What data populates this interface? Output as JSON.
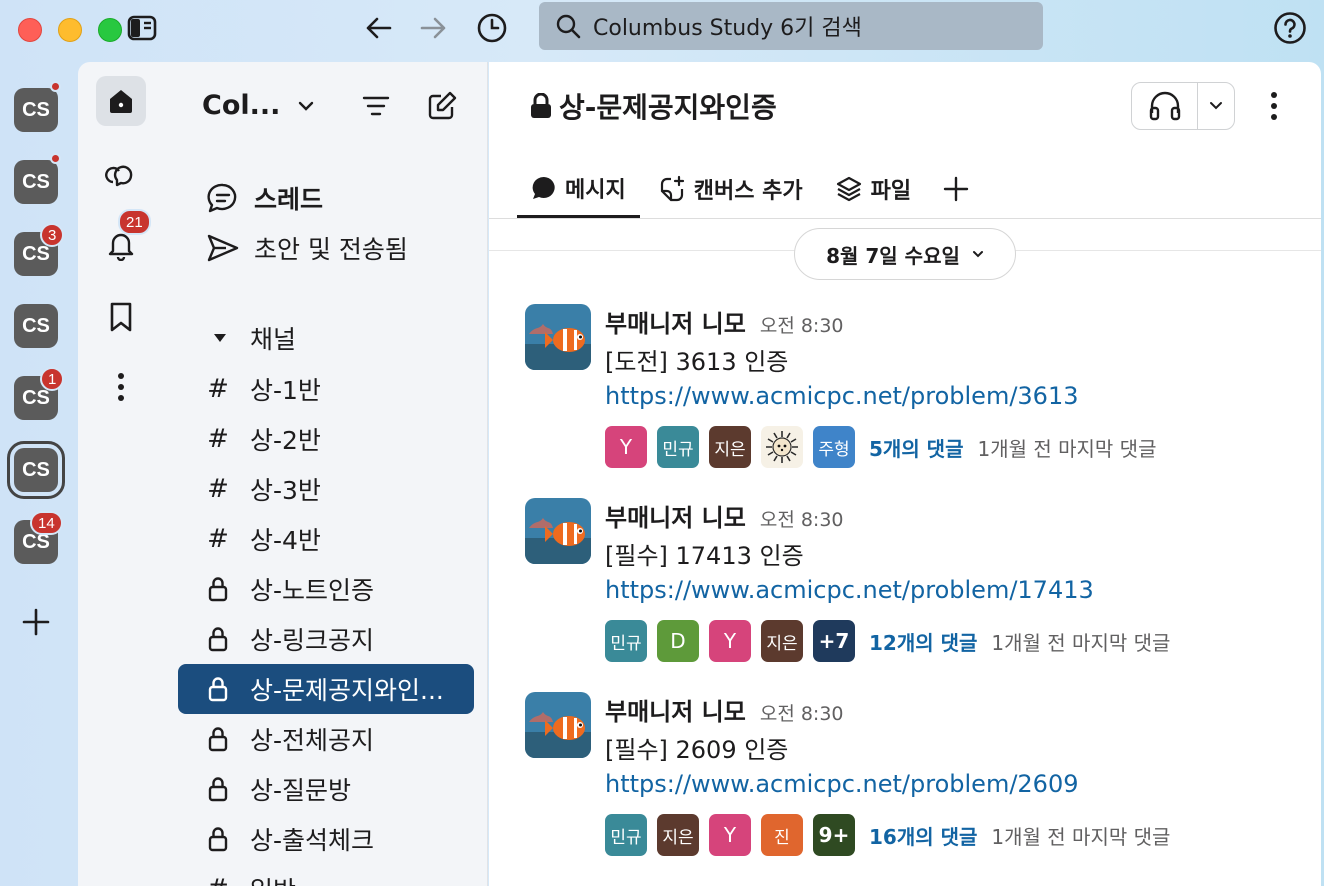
{
  "titlebar": {
    "search_text": "Columbus Study 6기 검색"
  },
  "workspaces": [
    {
      "label": "CS",
      "dot": true,
      "badge": ""
    },
    {
      "label": "CS",
      "dot": true,
      "badge": ""
    },
    {
      "label": "CS",
      "dot": false,
      "badge": "3"
    },
    {
      "label": "CS",
      "dot": false,
      "badge": ""
    },
    {
      "label": "CS",
      "dot": false,
      "badge": "1"
    },
    {
      "label": "CS",
      "dot": false,
      "badge": "",
      "active": true
    },
    {
      "label": "CS",
      "dot": false,
      "badge": "14"
    }
  ],
  "rail": {
    "activity_badge": "21"
  },
  "sidebar": {
    "workspace_name": "Col...",
    "threads_label": "스레드",
    "drafts_label": "초안 및 전송됨",
    "channels_header": "채널",
    "channels": [
      {
        "icon": "#",
        "name": "상-1반"
      },
      {
        "icon": "#",
        "name": "상-2반"
      },
      {
        "icon": "#",
        "name": "상-3반"
      },
      {
        "icon": "#",
        "name": "상-4반"
      },
      {
        "icon": "lock",
        "name": "상-노트인증"
      },
      {
        "icon": "lock",
        "name": "상-링크공지"
      },
      {
        "icon": "lock",
        "name": "상-문제공지와인...",
        "active": true
      },
      {
        "icon": "lock",
        "name": "상-전체공지"
      },
      {
        "icon": "lock",
        "name": "상-질문방"
      },
      {
        "icon": "lock",
        "name": "상-출석체크"
      },
      {
        "icon": "#",
        "name": "일반"
      }
    ]
  },
  "channel": {
    "title": "상-문제공지와인증",
    "tabs": [
      {
        "label": "메시지",
        "active": true
      },
      {
        "label": "캔버스 추가"
      },
      {
        "label": "파일"
      }
    ],
    "date_divider": "8월 7일 수요일"
  },
  "messages": [
    {
      "author": "부매니저 니모",
      "time": "오전 8:30",
      "text": "[도전] 3613 인증",
      "link": "https://www.acmicpc.net/problem/3613",
      "repliers": [
        {
          "label": "Y",
          "color": "#d6447b"
        },
        {
          "label": "민규",
          "color": "#3a8a98"
        },
        {
          "label": "지은",
          "color": "#5c3a2e"
        },
        {
          "label": "hedgehog",
          "color": "#f6f1e6",
          "image": true
        },
        {
          "label": "주형",
          "color": "#3f84c9"
        }
      ],
      "reply_count": "5개의 댓글",
      "last_reply": "1개월 전 마지막 댓글"
    },
    {
      "author": "부매니저 니모",
      "time": "오전 8:30",
      "text": "[필수] 17413 인증",
      "link": "https://www.acmicpc.net/problem/17413",
      "repliers": [
        {
          "label": "민규",
          "color": "#3a8a98"
        },
        {
          "label": "D",
          "color": "#5e9a3a"
        },
        {
          "label": "Y",
          "color": "#d6447b"
        },
        {
          "label": "지은",
          "color": "#5c3a2e"
        },
        {
          "label": "+7",
          "color": "#1f3a5c"
        }
      ],
      "reply_count": "12개의 댓글",
      "last_reply": "1개월 전 마지막 댓글"
    },
    {
      "author": "부매니저 니모",
      "time": "오전 8:30",
      "text": "[필수] 2609 인증",
      "link": "https://www.acmicpc.net/problem/2609",
      "repliers": [
        {
          "label": "민규",
          "color": "#3a8a98"
        },
        {
          "label": "지은",
          "color": "#5c3a2e"
        },
        {
          "label": "Y",
          "color": "#d6447b"
        },
        {
          "label": "진",
          "color": "#e0662e"
        },
        {
          "label": "9+",
          "color": "#2f4a22"
        }
      ],
      "reply_count": "16개의 댓글",
      "last_reply": "1개월 전 마지막 댓글"
    }
  ]
}
